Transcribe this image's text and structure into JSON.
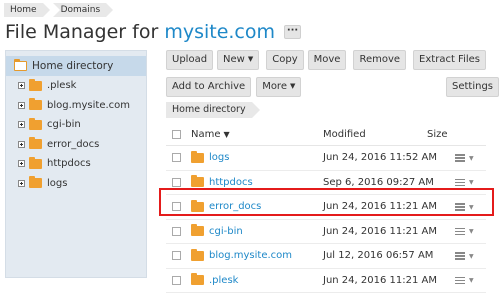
{
  "breadcrumb": [
    "Home",
    "Domains"
  ],
  "title": {
    "prefix": "File Manager for ",
    "site": "mysite.com",
    "more_label": "···"
  },
  "sidebar": {
    "root": "Home directory",
    "items": [
      ".plesk",
      "blog.mysite.com",
      "cgi-bin",
      "error_docs",
      "httpdocs",
      "logs"
    ]
  },
  "toolbar": {
    "upload": "Upload",
    "new": "New",
    "copy": "Copy",
    "move": "Move",
    "remove": "Remove",
    "extract": "Extract Files",
    "add_archive": "Add to Archive",
    "more": "More",
    "settings": "Settings"
  },
  "path": "Home directory",
  "table": {
    "headers": {
      "name": "Name",
      "modified": "Modified",
      "size": "Size"
    },
    "rows": [
      {
        "name": "logs",
        "modified": "Jun 24, 2016 11:52 AM"
      },
      {
        "name": "httpdocs",
        "modified": "Sep 6, 2016 09:27 AM"
      },
      {
        "name": "error_docs",
        "modified": "Jun 24, 2016 11:21 AM"
      },
      {
        "name": "cgi-bin",
        "modified": "Jun 24, 2016 11:21 AM"
      },
      {
        "name": "blog.mysite.com",
        "modified": "Jul 12, 2016 06:57 AM"
      },
      {
        "name": ".plesk",
        "modified": "Jun 24, 2016 11:21 AM"
      }
    ]
  },
  "colors": {
    "link": "#1e88c8",
    "highlight": "#e41b1b",
    "folder": "#f0a030"
  }
}
